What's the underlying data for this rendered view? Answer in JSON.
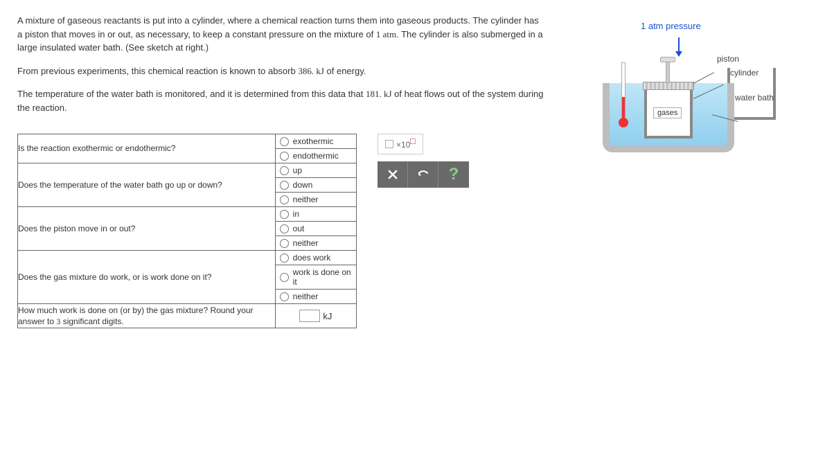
{
  "problem": {
    "p1_a": "A mixture of gaseous reactants is put into a cylinder, where a chemical reaction turns them into gaseous products. The cylinder has a piston that moves in or out, as necessary, to keep a constant pressure on the mixture of ",
    "p1_num": "1 atm",
    "p1_b": ". The cylinder is also submerged in a large insulated water bath. (See sketch at right.)",
    "p2_a": "From previous experiments, this chemical reaction is known to absorb ",
    "p2_num": "386. kJ",
    "p2_b": " of energy.",
    "p3_a": "The temperature of the water bath is monitored, and it is determined from this data that ",
    "p3_num": "181. kJ",
    "p3_b": " of heat flows out of the system during the reaction."
  },
  "questions": [
    {
      "prompt": "Is the reaction exothermic or endothermic?",
      "options": [
        "exothermic",
        "endothermic"
      ]
    },
    {
      "prompt": "Does the temperature of the water bath go up or down?",
      "options": [
        "up",
        "down",
        "neither"
      ]
    },
    {
      "prompt": "Does the piston move in or out?",
      "options": [
        "in",
        "out",
        "neither"
      ]
    },
    {
      "prompt": "Does the gas mixture do work, or is work done on it?",
      "options": [
        "does work",
        "work is done on it",
        "neither"
      ]
    }
  ],
  "q5": {
    "prompt_a": "How much work is done on (or by) the gas mixture? Round your answer to ",
    "prompt_num": "3",
    "prompt_b": " significant digits.",
    "unit": "kJ"
  },
  "exponent_btn": "×10",
  "diagram": {
    "pressure": "1 atm pressure",
    "piston": "piston",
    "cylinder": "cylinder",
    "waterbath": "water bath",
    "gases": "gases"
  }
}
